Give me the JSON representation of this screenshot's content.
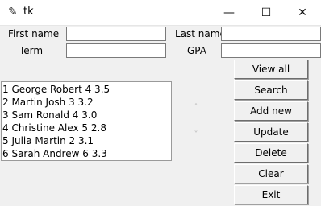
{
  "window": {
    "title": "tk",
    "icon": "feather-icon",
    "controls": {
      "minimize": "—",
      "maximize": "☐",
      "close": "✕"
    }
  },
  "form": {
    "first_name_label": "First name",
    "last_name_label": "Last name",
    "term_label": "Term",
    "gpa_label": "GPA",
    "first_name_value": "",
    "last_name_value": "",
    "term_value": "",
    "gpa_value": ""
  },
  "records": [
    "1 George Robert 4 3.5",
    "2 Martin Josh 3 3.2",
    "3 Sam Ronald 4 3.0",
    "4 Christine Alex 5 2.8",
    "5 Julia Martin 2 3.1",
    "6 Sarah Andrew 6 3.3"
  ],
  "scrollbar": {
    "up": "˄",
    "down": "˅"
  },
  "buttons": {
    "view_all": "View all",
    "search": "Search",
    "add_new": "Add new",
    "update": "Update",
    "delete": "Delete",
    "clear": "Clear",
    "exit": "Exit"
  }
}
